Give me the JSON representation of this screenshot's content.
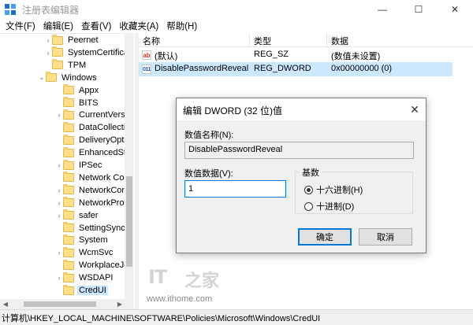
{
  "window": {
    "title": "注册表编辑器",
    "minimize_glyph": "—",
    "maximize_glyph": "☐",
    "close_glyph": "✕"
  },
  "menu": [
    "文件(F)",
    "编辑(E)",
    "查看(V)",
    "收藏夹(A)",
    "帮助(H)"
  ],
  "tree": {
    "items": [
      {
        "label": "Peernet",
        "chevron": ">"
      },
      {
        "label": "SystemCertificate",
        "chevron": ">"
      },
      {
        "label": "TPM",
        "chevron": ""
      },
      {
        "label": "Windows",
        "chevron": "v"
      },
      {
        "label": "Appx",
        "chevron": ""
      },
      {
        "label": "BITS",
        "chevron": ""
      },
      {
        "label": "CurrentVersic",
        "chevron": ">"
      },
      {
        "label": "DataCollectio",
        "chevron": ""
      },
      {
        "label": "DeliveryOptin",
        "chevron": ""
      },
      {
        "label": "EnhancedStor",
        "chevron": ""
      },
      {
        "label": "IPSec",
        "chevron": ">"
      },
      {
        "label": "Network Con",
        "chevron": ""
      },
      {
        "label": "NetworkConr",
        "chevron": ">"
      },
      {
        "label": "NetworkProv",
        "chevron": ">"
      },
      {
        "label": "safer",
        "chevron": ">"
      },
      {
        "label": "SettingSync",
        "chevron": ""
      },
      {
        "label": "System",
        "chevron": ""
      },
      {
        "label": "WcmSvc",
        "chevron": ">"
      },
      {
        "label": "WorkplaceJo",
        "chevron": ""
      },
      {
        "label": "WSDAPI",
        "chevron": ">"
      },
      {
        "label": "CredUI",
        "chevron": ""
      }
    ]
  },
  "list": {
    "headers": {
      "name": "名称",
      "type": "类型",
      "data": "数据"
    },
    "rows": [
      {
        "icon": "ab",
        "name": "(默认)",
        "type": "REG_SZ",
        "data": "(数值未设置)"
      },
      {
        "icon": "011",
        "name": "DisablePasswordReveal",
        "type": "REG_DWORD",
        "data": "0x00000000 (0)"
      }
    ]
  },
  "statusbar": {
    "path": "计算机\\HKEY_LOCAL_MACHINE\\SOFTWARE\\Policies\\Microsoft\\Windows\\CredUI"
  },
  "dialog": {
    "title": "编辑 DWORD (32 位)值",
    "close_glyph": "✕",
    "value_name_label": "数值名称(N):",
    "value_name": "DisablePasswordReveal",
    "value_data_label": "数值数据(V):",
    "value_data": "1",
    "base_label": "基数",
    "base_hex": "十六进制(H)",
    "base_dec": "十进制(D)",
    "ok": "确定",
    "cancel": "取消"
  },
  "watermark": {
    "logo_left": "IT",
    "logo_right": "之家",
    "url": "www.ithome.com"
  }
}
